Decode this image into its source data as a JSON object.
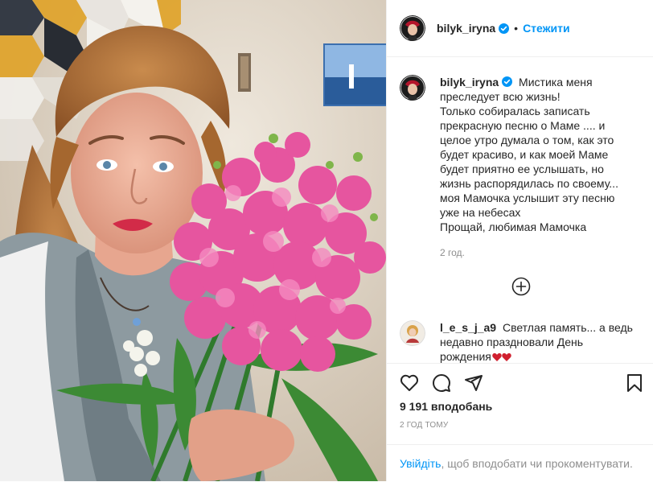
{
  "author": {
    "username": "bilyk_iryna",
    "verified": true,
    "separator": "•",
    "follow_label": "Стежити"
  },
  "caption": {
    "username": "bilyk_iryna",
    "lines": [
      "Мистика меня",
      "преследует всю жизнь!",
      "Только собиралась записать",
      "прекрасную песню о Маме .... и",
      "целое утро думала о том, как это",
      "будет красиво, и как моей Маме",
      "будет приятно ее услышать, но",
      "жизнь распорядилась по своему...",
      "моя Мамочка услышит эту песню",
      "уже на небесах",
      "Прощай, любимая Мамочка"
    ],
    "time": "2 год."
  },
  "load_more_icon": "plus-circle-icon",
  "comment": {
    "username": "l_e_s_j_a9",
    "lines": [
      "Светлая память... а ведь",
      "недавно праздновали День",
      "рождения"
    ],
    "emoji": "hearts"
  },
  "actions": {
    "like_icon": "heart-icon",
    "comment_icon": "comment-icon",
    "share_icon": "share-icon",
    "save_icon": "bookmark-icon"
  },
  "likes_text": "9 191 вподобань",
  "time_ago": "2 ГОД ТОМУ",
  "login": {
    "link": "Увійдіть",
    "rest": ", щоб вподобати чи прокоментувати."
  },
  "colors": {
    "accent": "#0095f6",
    "text": "#262626",
    "muted": "#8e8e8e",
    "border": "#efefef",
    "flowers": "#e6559f"
  }
}
